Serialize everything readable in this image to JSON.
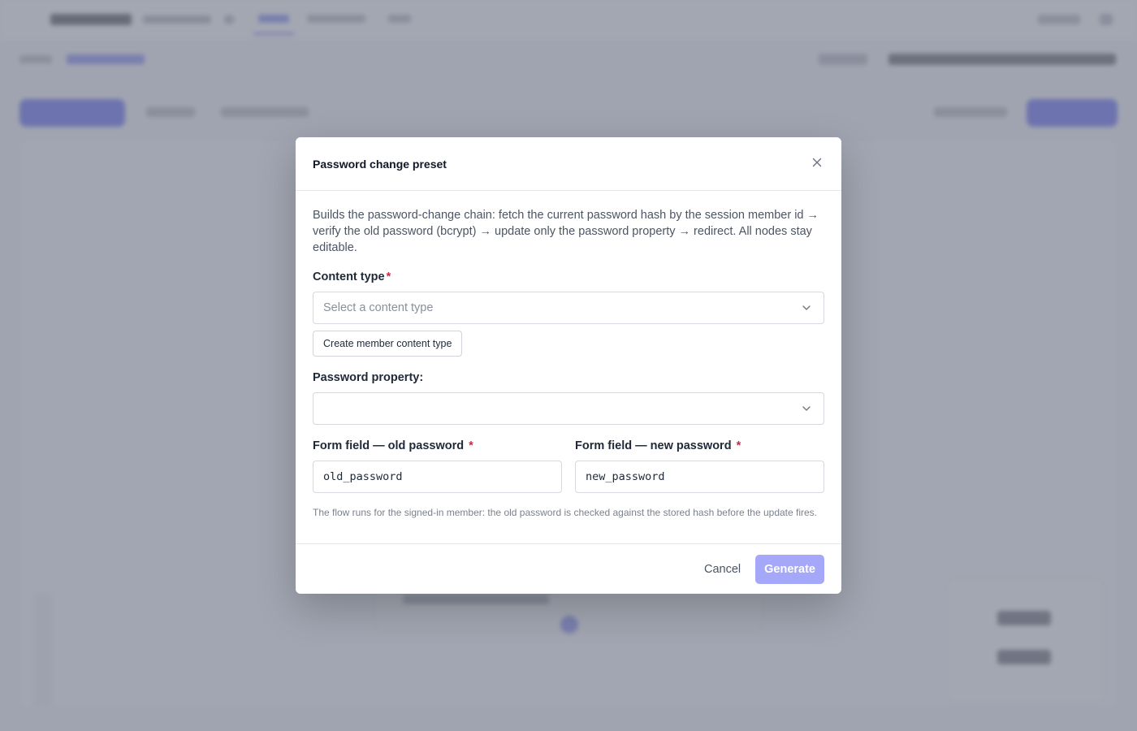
{
  "modal": {
    "title": "Password change preset",
    "description": "Builds the password-change chain: fetch the current password hash by the session member id → verify the old password (bcrypt) → update only the password property → redirect. All nodes stay editable.",
    "content_type": {
      "label": "Content type",
      "required_mark": "*",
      "placeholder": "Select a content type",
      "create_button": "Create member content type"
    },
    "password_property": {
      "label": "Password property:",
      "value": ""
    },
    "old_password_field": {
      "label": "Form field — old password",
      "required_mark": "*",
      "value": "old_password"
    },
    "new_password_field": {
      "label": "Form field — new password",
      "required_mark": "*",
      "value": "new_password"
    },
    "hint": "The flow runs for the signed-in member: the old password is checked against the stored hash before the update fires.",
    "footer": {
      "cancel_label": "Cancel",
      "generate_label": "Generate",
      "generate_disabled": true
    }
  },
  "colors": {
    "accent": "#3f46ef",
    "generate_disabled": "#a5a7f8",
    "required": "#e11d48"
  },
  "icons": {
    "close": "close-icon",
    "select_chevron": "chevron-down-icon"
  }
}
